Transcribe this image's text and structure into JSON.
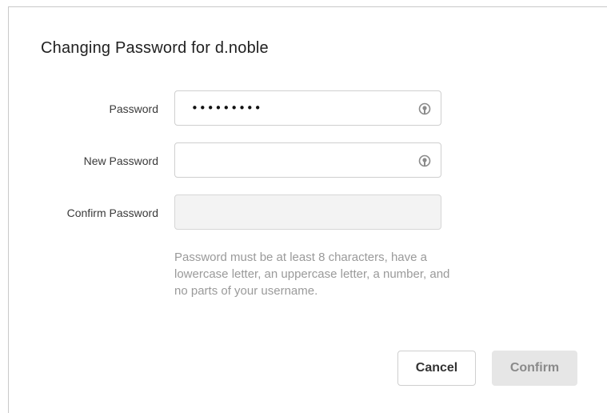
{
  "dialog": {
    "title": "Changing Password for d.noble"
  },
  "form": {
    "password": {
      "label": "Password",
      "value": "•••••••••",
      "icon": "eye-toggle-icon"
    },
    "new_password": {
      "label": "New Password",
      "value": "",
      "icon": "eye-toggle-icon"
    },
    "confirm_password": {
      "label": "Confirm Password",
      "value": "",
      "disabled": true
    },
    "hint": "Password must be at least 8 characters, have a lowercase letter, an uppercase letter, a number, and no parts of your username."
  },
  "actions": {
    "cancel_label": "Cancel",
    "confirm_label": "Confirm",
    "confirm_disabled": true
  }
}
